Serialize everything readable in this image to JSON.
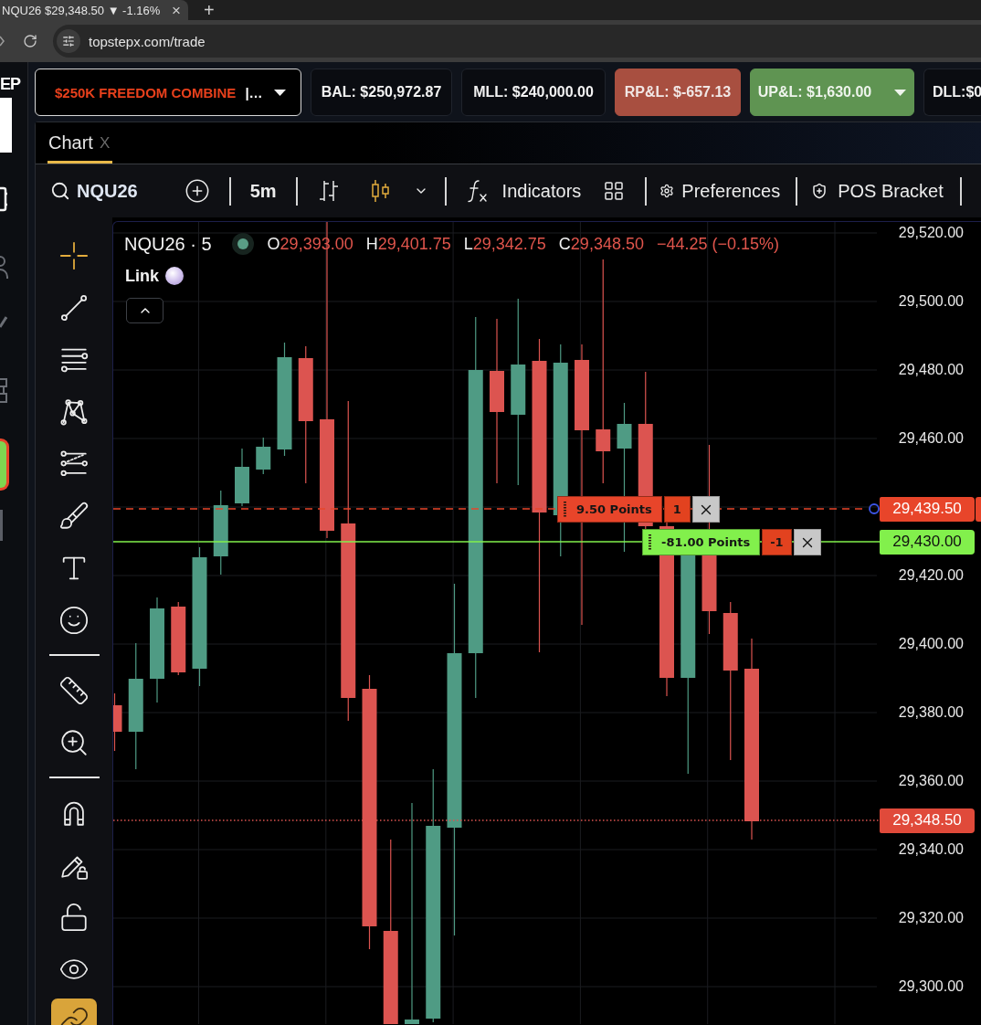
{
  "browser": {
    "tab": {
      "title": "NQU26 $29,348.50 ▼ -1.16%",
      "close": "×"
    },
    "new_tab": "+",
    "url": "topstepx.com/trade"
  },
  "app_sidebar": {
    "logo": "EP"
  },
  "account_bar": {
    "account": {
      "name": "$250K FREEDOM COMBINE",
      "suffix": "|…"
    },
    "stats": [
      {
        "kind": "plain",
        "text": "BAL: $250,972.87",
        "dropdown": false
      },
      {
        "kind": "plain",
        "text": "MLL: $240,000.00",
        "dropdown": false
      },
      {
        "kind": "loss",
        "text": "RP&L: $-657.13",
        "dropdown": false
      },
      {
        "kind": "gain",
        "text": "UP&L: $1,630.00",
        "dropdown": true
      },
      {
        "kind": "plain",
        "text": "DLL:$0"
      }
    ]
  },
  "chart_tabs": [
    {
      "label": "Chart",
      "close": "X",
      "selected": true
    }
  ],
  "toolbar": {
    "symbol": "NQU26",
    "interval": "5m",
    "chart_styles": [
      {
        "kind": "bars",
        "selected": false
      },
      {
        "kind": "candles",
        "selected": true
      }
    ],
    "indicators": "Indicators",
    "preferences": "Preferences",
    "pos_bracket": "POS Bracket"
  },
  "drawing_tools": {
    "groups": [
      {
        "kind": "tools",
        "tools": [
          {
            "kind": "crosshair",
            "selected": true
          },
          {
            "kind": "trend_line",
            "selected": false
          },
          {
            "kind": "parallel_lines",
            "selected": false
          },
          {
            "kind": "pattern",
            "selected": false
          },
          {
            "kind": "fib",
            "selected": false
          },
          {
            "kind": "brush",
            "selected": false
          },
          {
            "kind": "text",
            "selected": false
          },
          {
            "kind": "emoji",
            "selected": false
          }
        ]
      },
      {
        "kind": "tools",
        "tools": [
          {
            "kind": "ruler",
            "selected": false
          },
          {
            "kind": "zoom",
            "selected": false
          }
        ]
      },
      {
        "kind": "toggles",
        "tools": [
          {
            "kind": "magnet",
            "on": false
          },
          {
            "kind": "lock_drawings",
            "on": false
          },
          {
            "kind": "lock",
            "on": false
          },
          {
            "kind": "hide",
            "on": false
          },
          {
            "kind": "link",
            "on": true
          }
        ]
      }
    ]
  },
  "chart": {
    "legend": {
      "title": "NQU26 · 5",
      "values": [
        {
          "key": "O",
          "value": "29,393.00"
        },
        {
          "key": "H",
          "value": "29,401.75"
        },
        {
          "key": "L",
          "value": "29,342.75"
        },
        {
          "key": "C",
          "value": "29,348.50"
        }
      ],
      "change": "−44.25 (−0.15%)"
    },
    "link": "Link",
    "price_ticks": [
      "29,520.00",
      "29,500.00",
      "29,480.00",
      "29,460.00",
      "29,420.00",
      "29,400.00",
      "29,380.00",
      "29,360.00",
      "29,340.00",
      "29,320.00",
      "29,300.00"
    ],
    "order_lines": [
      {
        "kind": "dashed",
        "points": "9.50 Points",
        "quantity": "1",
        "price": "29,439.50",
        "color": "#e8452a"
      },
      {
        "kind": "solid",
        "points": "-81.00 Points",
        "quantity": "-1",
        "price": "29,430.00",
        "color": "#82f04c"
      }
    ],
    "last_price": "29,348.50"
  }
}
